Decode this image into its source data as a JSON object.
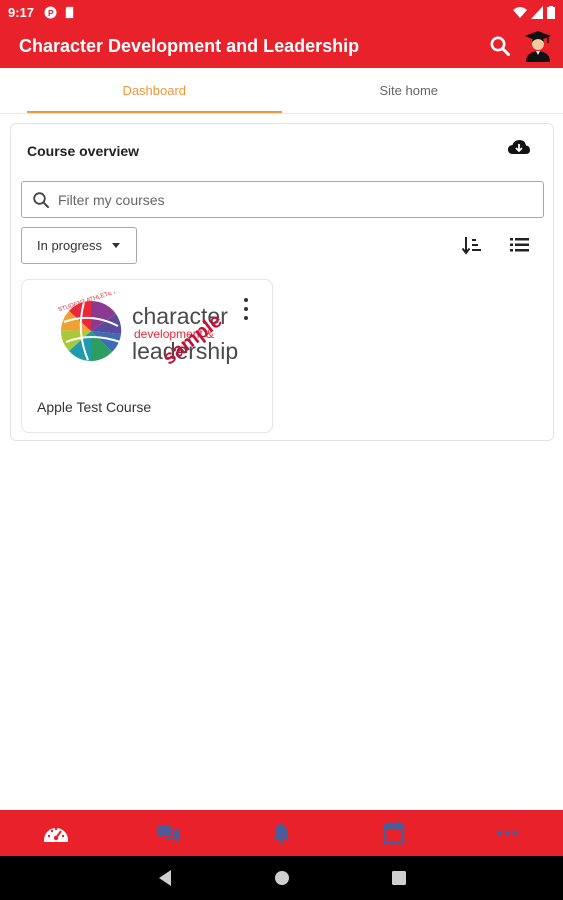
{
  "status_bar": {
    "time": "9:17"
  },
  "app_bar": {
    "title": "Character Development and Leadership",
    "search_icon": "search-icon",
    "avatar_icon": "graduate-avatar-icon"
  },
  "tabs": [
    {
      "label": "Dashboard",
      "active": true
    },
    {
      "label": "Site home",
      "active": false
    }
  ],
  "course_overview": {
    "title": "Course overview",
    "download_icon": "cloud-download-icon",
    "search": {
      "placeholder": "Filter my courses",
      "value": ""
    },
    "filter": {
      "selected": "In progress"
    },
    "sort_icon": "sort-icon",
    "view_icon": "list-view-icon",
    "courses": [
      {
        "name": "Apple Test Course",
        "image": {
          "line1": "character",
          "line2": "development &",
          "line3": "leadership",
          "arc_text": "STUDENT ATHLETE PROGRAM",
          "watermark": "sample"
        }
      }
    ]
  },
  "bottom_nav": [
    {
      "name": "dashboard-icon",
      "active": true
    },
    {
      "name": "messages-icon",
      "active": false
    },
    {
      "name": "notifications-icon",
      "active": false
    },
    {
      "name": "calendar-icon",
      "active": false
    },
    {
      "name": "more-icon",
      "active": false
    }
  ],
  "colors": {
    "brand_red": "#e8212b",
    "tab_accent": "#f0973a",
    "inactive_nav_icon": "#4b5d98"
  }
}
